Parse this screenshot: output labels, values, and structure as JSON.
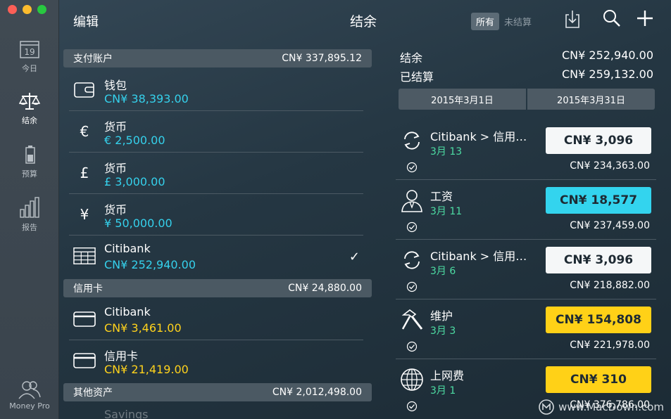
{
  "sidebar": {
    "calendar_day": "19",
    "items": [
      {
        "label": "今日"
      },
      {
        "label": "结余"
      },
      {
        "label": "预算"
      },
      {
        "label": "报告"
      }
    ],
    "footer_label": "Money Pro"
  },
  "toolbar": {
    "edit_label": "编辑",
    "title": "结余",
    "filter_all": "所有",
    "filter_unreconciled": "未结算"
  },
  "sections": [
    {
      "title": "支付账户",
      "total": "CN¥ 337,895.12"
    },
    {
      "title": "信用卡",
      "total": "CN¥ 24,880.00"
    },
    {
      "title": "其他资产",
      "total": "CN¥ 2,012,498.00"
    }
  ],
  "accounts": [
    {
      "name": "钱包",
      "amount": "CN¥ 38,393.00",
      "icon": "wallet-icon",
      "symbol": ""
    },
    {
      "name": "货币",
      "amount": "€ 2,500.00",
      "icon": "euro-icon",
      "symbol": "€"
    },
    {
      "name": "货币",
      "amount": "£ 3,000.00",
      "icon": "pound-icon",
      "symbol": "£"
    },
    {
      "name": "货币",
      "amount": "¥ 50,000.00",
      "icon": "yen-icon",
      "symbol": "¥"
    },
    {
      "name": "Citibank",
      "amount": "CN¥ 252,940.00",
      "icon": "bank-icon",
      "symbol": "",
      "checkmark": "✓"
    },
    {
      "name": "Citibank",
      "amount": "CN¥ 3,461.00",
      "icon": "card-icon",
      "symbol": ""
    },
    {
      "name": "信用卡",
      "amount": "CN¥ 21,419.00",
      "icon": "card-icon",
      "symbol": ""
    },
    {
      "name": "Savings",
      "amount": "",
      "icon": "savings-icon",
      "symbol": ""
    }
  ],
  "summary": {
    "balance_label": "结余",
    "balance_value": "CN¥ 252,940.00",
    "reconciled_label": "已结算",
    "reconciled_value": "CN¥ 259,132.00",
    "date_start": "2015年3月1日",
    "date_end": "2015年3月31日"
  },
  "transactions": [
    {
      "name": "Citibank > 信用…",
      "date": "3月 13",
      "amount": "CN¥ 3,096",
      "balance": "CN¥ 234,363.00",
      "icon": "transfer-icon",
      "color": "#f5f7f8"
    },
    {
      "name": "工资",
      "date": "3月 11",
      "amount": "CN¥ 18,577",
      "balance": "CN¥ 237,459.00",
      "icon": "person-icon",
      "color": "#33d4ee"
    },
    {
      "name": "Citibank > 信用…",
      "date": "3月 6",
      "amount": "CN¥ 3,096",
      "balance": "CN¥ 218,882.00",
      "icon": "transfer-icon",
      "color": "#f5f7f8"
    },
    {
      "name": "维护",
      "date": "3月 3",
      "amount": "CN¥ 154,808",
      "balance": "CN¥ 221,978.00",
      "icon": "hammer-icon",
      "color": "#ffd117"
    },
    {
      "name": "上网费",
      "date": "3月 1",
      "amount": "CN¥ 310",
      "balance": "CN¥ 376,786.00",
      "icon": "globe-icon",
      "color": "#ffd117"
    }
  ],
  "watermark": "www.MacDown.com"
}
